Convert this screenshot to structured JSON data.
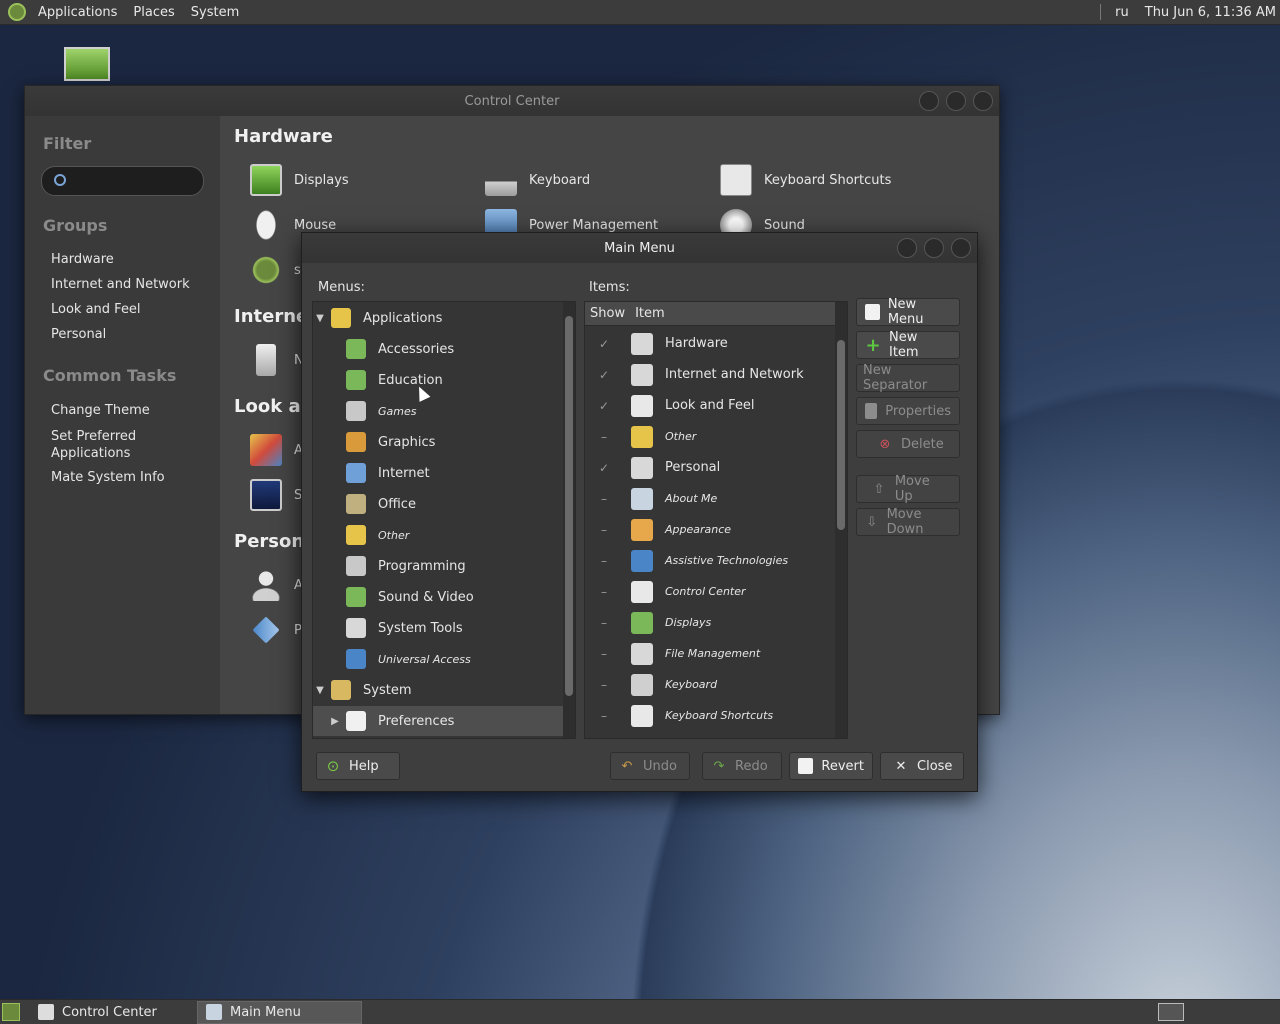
{
  "top_panel": {
    "menus": [
      "Applications",
      "Places",
      "System"
    ],
    "keyboard_layout": "ru",
    "clock": "Thu Jun  6, 11:36 AM"
  },
  "taskbar": {
    "tasks": [
      {
        "label": "Control Center"
      },
      {
        "label": "Main Menu"
      }
    ]
  },
  "control_center": {
    "title": "Control Center",
    "filter_label": "Filter",
    "groups_label": "Groups",
    "groups": [
      "Hardware",
      "Internet and Network",
      "Look and Feel",
      "Personal"
    ],
    "common_tasks_label": "Common Tasks",
    "common_tasks": [
      "Change Theme",
      "Set Preferred Applications",
      "Mate System Info"
    ],
    "sections": {
      "hardware": "Hardware",
      "internet": "Internet",
      "look": "Look an",
      "personal": "Persona"
    },
    "hardware_items": [
      "Displays",
      "Keyboard",
      "Keyboard Shortcuts",
      "Mouse",
      "Power Management",
      "Sound"
    ],
    "partial_labels": [
      "s",
      "N",
      "A",
      "S",
      "A",
      "P"
    ]
  },
  "main_menu": {
    "title": "Main Menu",
    "menus_label": "Menus:",
    "items_label": "Items:",
    "menus": [
      {
        "label": "Applications",
        "level": 0,
        "expander": "▼",
        "italic": false
      },
      {
        "label": "Accessories",
        "level": 1,
        "italic": false
      },
      {
        "label": "Education",
        "level": 1,
        "italic": false
      },
      {
        "label": "Games",
        "level": 1,
        "italic": true
      },
      {
        "label": "Graphics",
        "level": 1,
        "italic": false
      },
      {
        "label": "Internet",
        "level": 1,
        "italic": false
      },
      {
        "label": "Office",
        "level": 1,
        "italic": false
      },
      {
        "label": "Other",
        "level": 1,
        "italic": true
      },
      {
        "label": "Programming",
        "level": 1,
        "italic": false
      },
      {
        "label": "Sound & Video",
        "level": 1,
        "italic": false
      },
      {
        "label": "System Tools",
        "level": 1,
        "italic": false
      },
      {
        "label": "Universal Access",
        "level": 1,
        "italic": true
      },
      {
        "label": "System",
        "level": 0,
        "expander": "▼",
        "italic": false
      },
      {
        "label": "Preferences",
        "level": 1,
        "expander": "▶",
        "italic": false,
        "selected": true
      }
    ],
    "items_columns": {
      "show": "Show",
      "item": "Item"
    },
    "items": [
      {
        "label": "Hardware",
        "checked": true,
        "italic": false
      },
      {
        "label": "Internet and Network",
        "checked": true,
        "italic": false
      },
      {
        "label": "Look and Feel",
        "checked": true,
        "italic": false
      },
      {
        "label": "Other",
        "checked": false,
        "italic": true
      },
      {
        "label": "Personal",
        "checked": true,
        "italic": false
      },
      {
        "label": "About Me",
        "checked": false,
        "italic": true
      },
      {
        "label": "Appearance",
        "checked": false,
        "italic": true
      },
      {
        "label": "Assistive Technologies",
        "checked": false,
        "italic": true
      },
      {
        "label": "Control Center",
        "checked": false,
        "italic": true
      },
      {
        "label": "Displays",
        "checked": false,
        "italic": true
      },
      {
        "label": "File Management",
        "checked": false,
        "italic": true
      },
      {
        "label": "Keyboard",
        "checked": false,
        "italic": true
      },
      {
        "label": "Keyboard Shortcuts",
        "checked": false,
        "italic": true
      }
    ],
    "side_buttons": {
      "new_menu": "New Menu",
      "new_item": "New Item",
      "new_separator": "New Separator",
      "properties": "Properties",
      "delete": "Delete",
      "move_up": "Move Up",
      "move_down": "Move Down"
    },
    "bottom_buttons": {
      "help": "Help",
      "undo": "Undo",
      "redo": "Redo",
      "revert": "Revert",
      "close": "Close"
    }
  },
  "colors": {
    "panel": "#3c3c3c",
    "window": "#3e3e3e",
    "accent_green": "#6c8a3c",
    "icon_blue": "#4a86c7"
  }
}
